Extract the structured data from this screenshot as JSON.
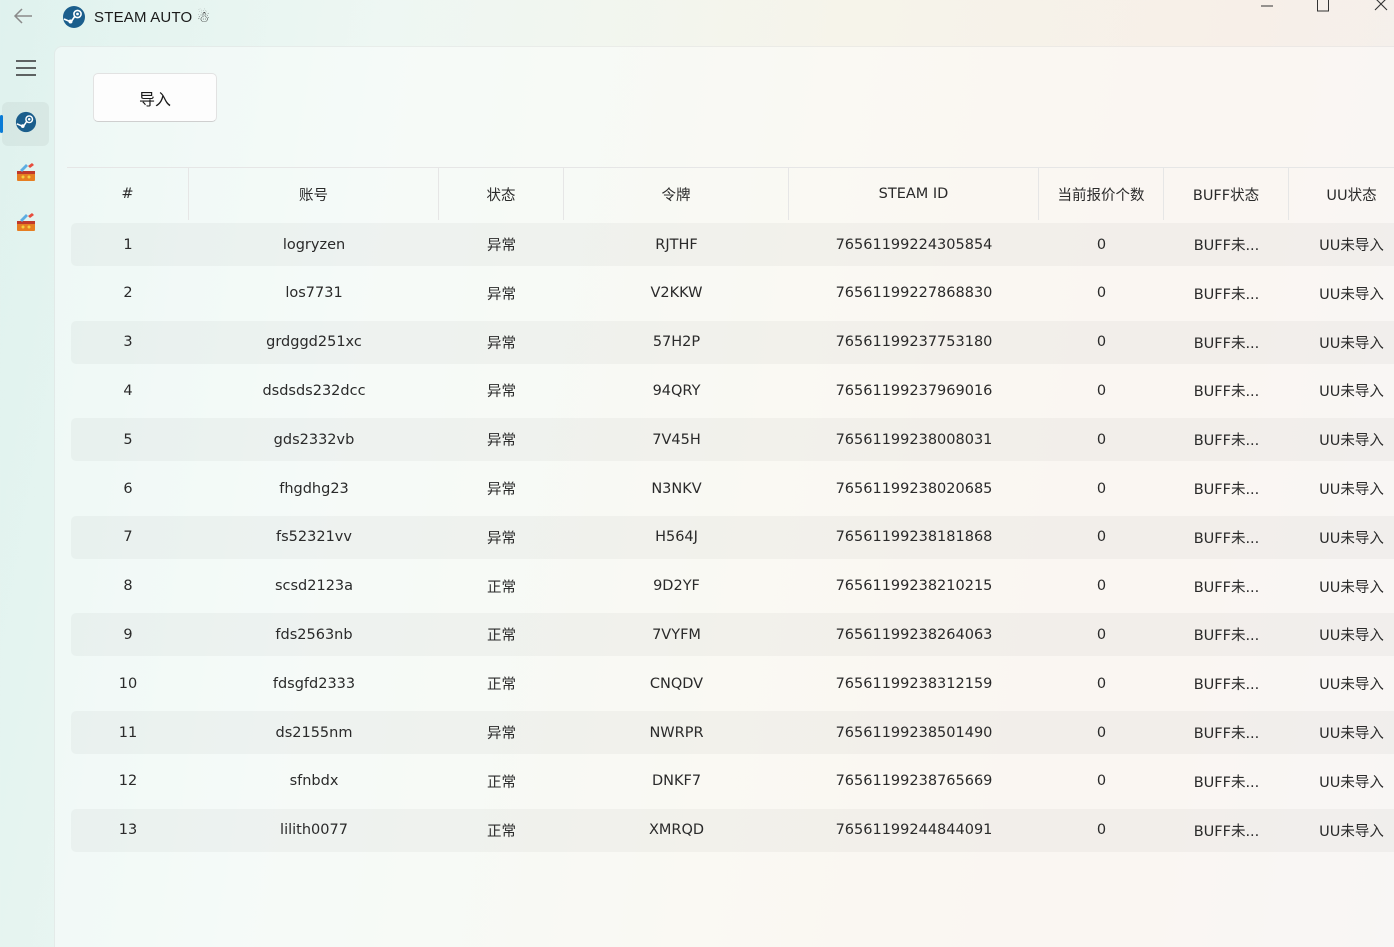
{
  "window": {
    "title": "STEAM AUTO ☃",
    "controls": [
      "minimize",
      "maximize",
      "close"
    ]
  },
  "sidebar": {
    "items": [
      {
        "name": "menu",
        "icon": "hamburger-menu-icon"
      },
      {
        "name": "steam",
        "icon": "steam-icon",
        "selected": true
      },
      {
        "name": "tool-1",
        "icon": "tool-icon"
      },
      {
        "name": "tool-2",
        "icon": "tool-icon"
      }
    ]
  },
  "toolbar": {
    "import_label": "导入"
  },
  "table": {
    "headers": [
      "#",
      "账号",
      "状态",
      "令牌",
      "STEAM ID",
      "当前报价个数",
      "BUFF状态",
      "UU状态"
    ],
    "rows": [
      [
        "1",
        "logryzen",
        "异常",
        "RJTHF",
        "76561199224305854",
        "0",
        "BUFF未...",
        "UU未导入"
      ],
      [
        "2",
        "los7731",
        "异常",
        "V2KKW",
        "76561199227868830",
        "0",
        "BUFF未...",
        "UU未导入"
      ],
      [
        "3",
        "grdggd251xc",
        "异常",
        "57H2P",
        "76561199237753180",
        "0",
        "BUFF未...",
        "UU未导入"
      ],
      [
        "4",
        "dsdsds232dcc",
        "异常",
        "94QRY",
        "76561199237969016",
        "0",
        "BUFF未...",
        "UU未导入"
      ],
      [
        "5",
        "gds2332vb",
        "异常",
        "7V45H",
        "76561199238008031",
        "0",
        "BUFF未...",
        "UU未导入"
      ],
      [
        "6",
        "fhgdhg23",
        "异常",
        "N3NKV",
        "76561199238020685",
        "0",
        "BUFF未...",
        "UU未导入"
      ],
      [
        "7",
        "fs52321vv",
        "异常",
        "H564J",
        "76561199238181868",
        "0",
        "BUFF未...",
        "UU未导入"
      ],
      [
        "8",
        "scsd2123a",
        "正常",
        "9D2YF",
        "76561199238210215",
        "0",
        "BUFF未...",
        "UU未导入"
      ],
      [
        "9",
        "fds2563nb",
        "正常",
        "7VYFM",
        "76561199238264063",
        "0",
        "BUFF未...",
        "UU未导入"
      ],
      [
        "10",
        "fdsgfd2333",
        "正常",
        "CNQDV",
        "76561199238312159",
        "0",
        "BUFF未...",
        "UU未导入"
      ],
      [
        "11",
        "ds2155nm",
        "异常",
        "NWRPR",
        "76561199238501490",
        "0",
        "BUFF未...",
        "UU未导入"
      ],
      [
        "12",
        "sfnbdx",
        "正常",
        "DNKF7",
        "76561199238765669",
        "0",
        "BUFF未...",
        "UU未导入"
      ],
      [
        "13",
        "lilith0077",
        "正常",
        "XMRQD",
        "76561199244844091",
        "0",
        "BUFF未...",
        "UU未导入"
      ]
    ]
  },
  "colors": {
    "accent": "#0a7bd6",
    "steam_logo": "#1b5e8c"
  }
}
